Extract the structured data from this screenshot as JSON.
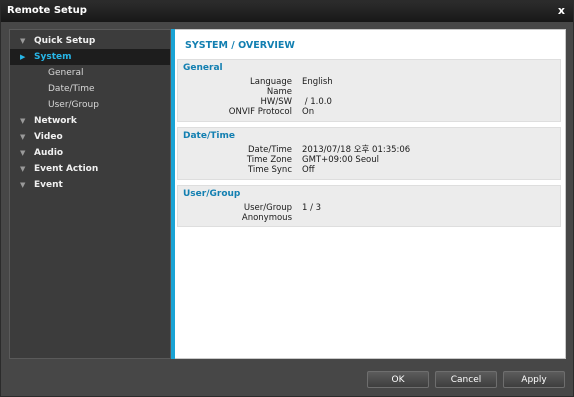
{
  "window": {
    "title": "Remote Setup",
    "close_glyph": "x"
  },
  "sidebar": {
    "items": [
      {
        "label": "Quick Setup",
        "arrow": "▼"
      },
      {
        "label": "System",
        "arrow": "▶",
        "active": true,
        "children": [
          {
            "label": "General"
          },
          {
            "label": "Date/Time"
          },
          {
            "label": "User/Group"
          }
        ]
      },
      {
        "label": "Network",
        "arrow": "▼"
      },
      {
        "label": "Video",
        "arrow": "▼"
      },
      {
        "label": "Audio",
        "arrow": "▼"
      },
      {
        "label": "Event Action",
        "arrow": "▼"
      },
      {
        "label": "Event",
        "arrow": "▼"
      }
    ]
  },
  "content": {
    "title": "SYSTEM / OVERVIEW",
    "general": {
      "heading": "General",
      "rows": [
        {
          "key": "Language",
          "value": "English"
        },
        {
          "key": "Name",
          "value": ""
        },
        {
          "key": "HW/SW",
          "value": " / 1.0.0"
        },
        {
          "key": "ONVIF Protocol",
          "value": "On"
        }
      ]
    },
    "datetime": {
      "heading": "Date/Time",
      "rows": [
        {
          "key": "Date/Time",
          "value": "2013/07/18 오후 01:35:06"
        },
        {
          "key": "Time Zone",
          "value": "GMT+09:00 Seoul"
        },
        {
          "key": "Time Sync",
          "value": "Off"
        }
      ]
    },
    "usergroup": {
      "heading": "User/Group",
      "rows": [
        {
          "key": "User/Group",
          "value": "1 / 3"
        },
        {
          "key": "Anonymous",
          "value": ""
        }
      ]
    }
  },
  "buttons": {
    "ok": "OK",
    "cancel": "Cancel",
    "apply": "Apply"
  },
  "colors": {
    "accent": "#1aa3d4",
    "heading": "#127fb1",
    "active_nav": "#27b6e8"
  },
  "icons": {
    "expand": "triangle-down-icon",
    "selected": "triangle-right-icon",
    "close": "close-icon"
  }
}
